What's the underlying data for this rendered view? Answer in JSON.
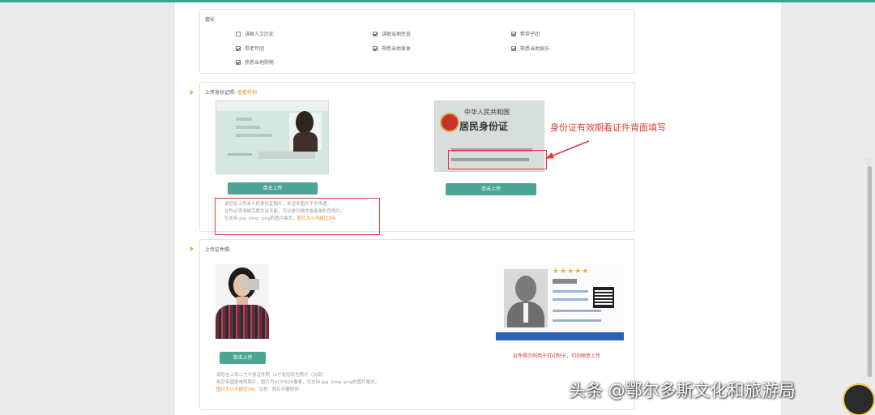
{
  "skills": {
    "label": "擅长",
    "items": [
      {
        "label": "讲解人文历史",
        "checked": false
      },
      {
        "label": "讲解当地民俗",
        "checked": true
      },
      {
        "label": "帮带子团",
        "checked": true
      },
      {
        "label": "带老年团",
        "checked": true
      },
      {
        "label": "熟悉当地美食",
        "checked": true
      },
      {
        "label": "熟悉当地娱乐",
        "checked": true
      },
      {
        "label": "熟悉当地购物",
        "checked": true
      }
    ]
  },
  "id_upload": {
    "label": "上传身份证照:",
    "example_link": "查看样例",
    "front_button": "单击上传",
    "back_button": "单击上传",
    "back_card_title": "中华人民共和国",
    "back_card_subtitle": "居民身份证",
    "annotation": "身份证有效期看证件背面填写",
    "notes": [
      "请您在上传本人的身份证图片，本证件图片不予传递。",
      "证件必须清晰完整并且不能，可以是扫描件或者是彩色照片。",
      "仅支持.jpg .bmp .png的图片格式，"
    ],
    "size_note": "图片大小不超过2M。"
  },
  "photo_upload": {
    "label": "上传证件照:",
    "button": "单击上传",
    "notes": [
      "请您在上传二寸半身证件照（2寸免冠彩色照片（白底）",
      "规范带国家电照照片，图片为413*626像素，仅支持.jpg .bmp .png的图片格式。"
    ],
    "size_note": "图片大小不超过2M。",
    "extra_note": "注意：照片不要修饰",
    "sample_caption": "证件照示例用于打印制卡，切勿随意上传"
  },
  "watermark": "头条 @鄂尔多斯文化和旅游局",
  "colors": {
    "accent": "#4aa594",
    "warn": "#f08b2a",
    "annotation": "#e23a3a"
  }
}
